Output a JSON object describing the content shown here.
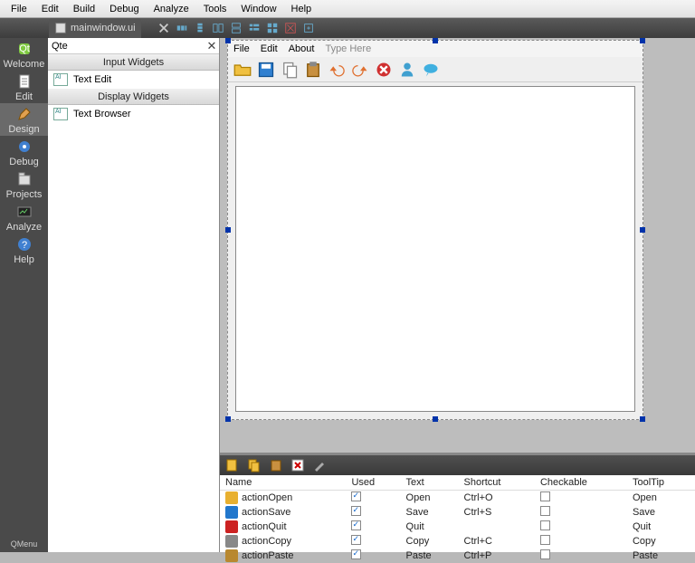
{
  "menubar": [
    "File",
    "Edit",
    "Build",
    "Debug",
    "Analyze",
    "Tools",
    "Window",
    "Help"
  ],
  "document_tab": "mainwindow.ui",
  "leftbar": [
    {
      "label": "Welcome",
      "icon": "qt"
    },
    {
      "label": "Edit",
      "icon": "edit"
    },
    {
      "label": "Design",
      "icon": "design",
      "selected": true
    },
    {
      "label": "Debug",
      "icon": "debug"
    },
    {
      "label": "Projects",
      "icon": "projects"
    },
    {
      "label": "Analyze",
      "icon": "analyze"
    },
    {
      "label": "Help",
      "icon": "help"
    }
  ],
  "statusbar": "QMenu",
  "widgetbox": {
    "search_value": "Qte",
    "categories": [
      {
        "title": "Input Widgets",
        "items": [
          {
            "label": "Text Edit"
          }
        ]
      },
      {
        "title": "Display Widgets",
        "items": [
          {
            "label": "Text Browser"
          }
        ]
      }
    ]
  },
  "form": {
    "menus": [
      "File",
      "Edit",
      "About"
    ],
    "type_here": "Type Here",
    "toolbar_icons": [
      "folder-open",
      "save",
      "copy",
      "paste",
      "undo",
      "redo",
      "quit",
      "user",
      "chat"
    ]
  },
  "action_table": {
    "headers": [
      "Name",
      "Used",
      "Text",
      "Shortcut",
      "Checkable",
      "ToolTip"
    ],
    "rows": [
      {
        "icon": "#e8b030",
        "name": "actionOpen",
        "used": true,
        "text": "Open",
        "shortcut": "Ctrl+O",
        "checkable": false,
        "tooltip": "Open"
      },
      {
        "icon": "#2277cc",
        "name": "actionSave",
        "used": true,
        "text": "Save",
        "shortcut": "Ctrl+S",
        "checkable": false,
        "tooltip": "Save"
      },
      {
        "icon": "#cc2222",
        "name": "actionQuit",
        "used": true,
        "text": "Quit",
        "shortcut": "",
        "checkable": false,
        "tooltip": "Quit"
      },
      {
        "icon": "#888888",
        "name": "actionCopy",
        "used": true,
        "text": "Copy",
        "shortcut": "Ctrl+C",
        "checkable": false,
        "tooltip": "Copy"
      },
      {
        "icon": "#b88830",
        "name": "actionPaste",
        "used": true,
        "text": "Paste",
        "shortcut": "Ctrl+P",
        "checkable": false,
        "tooltip": "Paste"
      }
    ]
  }
}
